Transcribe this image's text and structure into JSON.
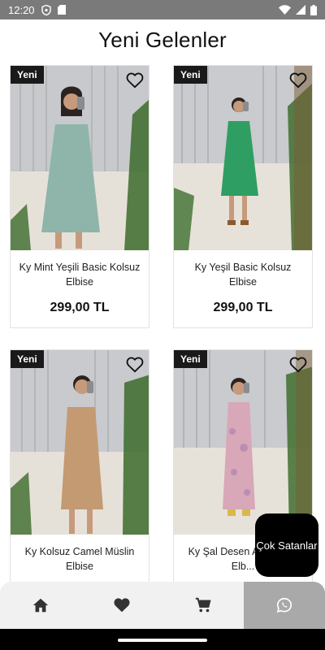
{
  "status_bar": {
    "time": "12:20",
    "icons": [
      "shield-icon",
      "sd-card-icon",
      "wifi-icon",
      "signal-icon",
      "battery-icon"
    ]
  },
  "page": {
    "title": "Yeni Gelenler"
  },
  "products": [
    {
      "badge": "Yeni",
      "name": "Ky Mint Yeşili Basic Kolsuz Elbise",
      "price": "299,00 TL",
      "dress_color": "#8fb5aa"
    },
    {
      "badge": "Yeni",
      "name": "Ky Yeşil Basic Kolsuz Elbise",
      "price": "299,00 TL",
      "dress_color": "#2f9e63"
    },
    {
      "badge": "Yeni",
      "name": "Ky Kolsuz Camel Müslin Elbise",
      "price": "",
      "dress_color": "#c49a72"
    },
    {
      "badge": "Yeni",
      "name": "Ky Şal Desen A... Elbise Elb...",
      "price": "",
      "dress_color": "#d8a7b8"
    }
  ],
  "fab": {
    "label": "Çok Satanlar"
  },
  "bottom_nav": {
    "items": [
      {
        "icon": "home-icon",
        "active": false
      },
      {
        "icon": "heart-icon",
        "active": false
      },
      {
        "icon": "cart-icon",
        "active": false
      },
      {
        "icon": "whatsapp-icon",
        "active": true
      }
    ]
  },
  "colors": {
    "status_bar": "#7a7a7a",
    "badge_bg": "#1a1a1a",
    "nav_bg": "#f1f1f1",
    "nav_active": "#a9a9a9",
    "fab_bg": "#000000"
  }
}
